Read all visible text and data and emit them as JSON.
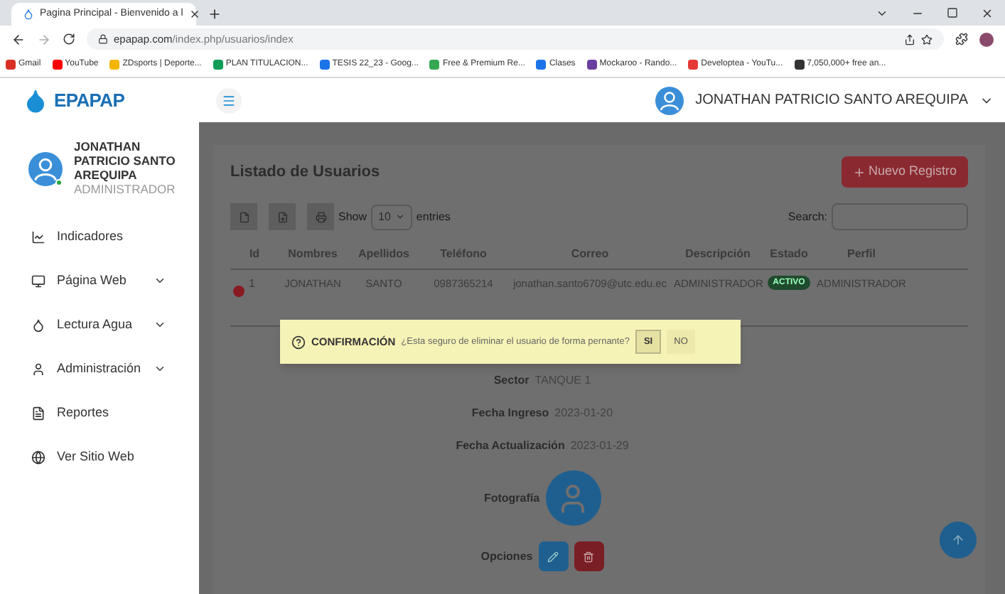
{
  "browser": {
    "tab_title": "Pagina Principal - Bienvenido a l",
    "url_host": "epapap.com",
    "url_path": "/index.php/usuarios/index",
    "bookmarks": [
      "Gmail",
      "YouTube",
      "ZDsports | Deporte...",
      "PLAN TITULACION...",
      "TESIS 22_23 - Goog...",
      "Free & Premium Re...",
      "Clases",
      "Mockaroo - Rando...",
      "Developtea - YouTu...",
      "7,050,000+ free an..."
    ]
  },
  "header": {
    "logo": "EPAPAP",
    "user_name": "JONATHAN PATRICIO SANTO AREQUIPA"
  },
  "sidebar": {
    "user": {
      "name": "JONATHAN PATRICIO SANTO AREQUIPA",
      "role": "ADMINISTRADOR",
      "online": true
    },
    "items": [
      {
        "label": "Indicadores",
        "expandable": false
      },
      {
        "label": "Página Web",
        "expandable": true
      },
      {
        "label": "Lectura Agua",
        "expandable": true
      },
      {
        "label": "Administración",
        "expandable": true
      },
      {
        "label": "Reportes",
        "expandable": false
      },
      {
        "label": "Ver Sitio Web",
        "expandable": false
      }
    ]
  },
  "content": {
    "title": "Listado de Usuarios",
    "new_button": "Nuevo Registro",
    "show_label": "Show",
    "page_size": "10",
    "entries_label": "entries",
    "search_label": "Search:",
    "columns": [
      "Id",
      "Nombres",
      "Apellidos",
      "Teléfono",
      "Correo",
      "Descripción",
      "Estado",
      "Perfil"
    ],
    "row": {
      "expanded": true,
      "id": "1",
      "nombres": "JONATHAN",
      "apellidos": "SANTO",
      "telefono": "0987365214",
      "correo": "jonathan.santo6709@utc.edu.ec",
      "descripcion": "ADMINISTRADOR",
      "estado": "ACTIVO",
      "perfil": "ADMINISTRADOR"
    },
    "details": [
      {
        "label": "Sector",
        "value": "TANQUE 1"
      },
      {
        "label": "Fecha Ingreso",
        "value": "2023-01-20"
      },
      {
        "label": "Fecha Actualización",
        "value": "2023-01-29"
      }
    ],
    "photo_label": "Fotografía",
    "options_label": "Opciones"
  },
  "dialog": {
    "title": "CONFIRMACIÓN",
    "message": "¿Esta seguro de eliminar el usuario de forma pernante?",
    "buttons": [
      {
        "label": "SI",
        "selected": true
      },
      {
        "label": "NO",
        "selected": false
      }
    ]
  }
}
